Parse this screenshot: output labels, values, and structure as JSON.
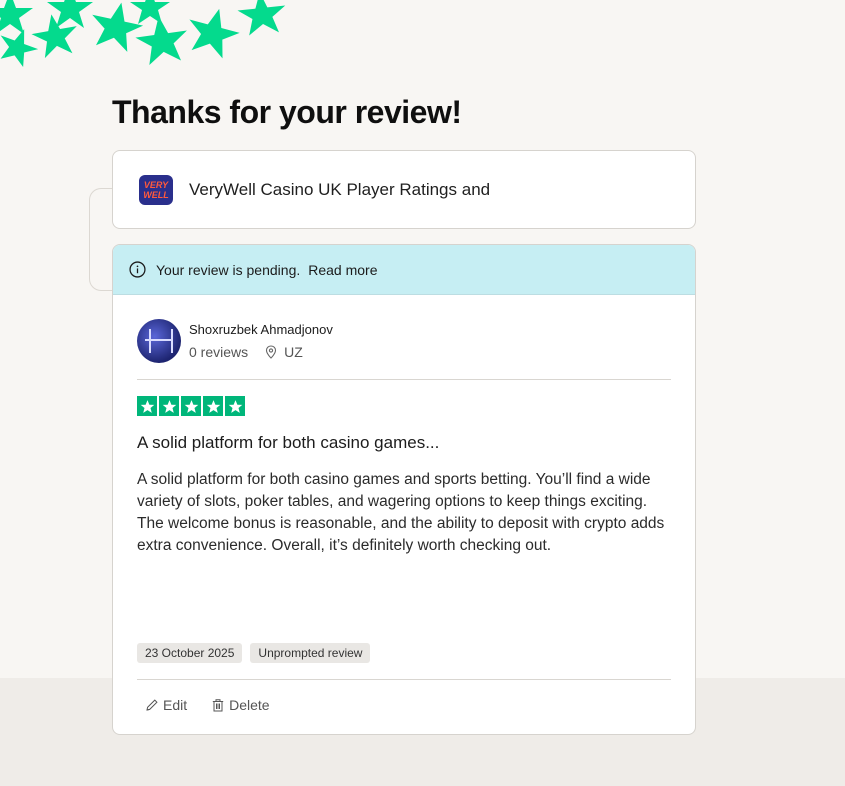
{
  "page": {
    "heading": "Thanks for your review!"
  },
  "business": {
    "logo_text_top": "VERY",
    "logo_text_bottom": "WELL",
    "name": "VeryWell Casino UK Player Ratings and"
  },
  "pending": {
    "icon": "info-icon",
    "message": "Your review is pending.",
    "link": "Read more"
  },
  "reviewer": {
    "name": "Shoxruzbek Ahmadjonov",
    "reviews": "0 reviews",
    "location_icon": "location-pin-icon",
    "country": "UZ"
  },
  "review": {
    "rating": 5,
    "title": "A solid platform for both casino games...",
    "body": "A solid platform for both casino games and sports betting. You’ll find a wide variety of slots, poker tables, and wagering options to keep things exciting. The welcome bonus is reasonable, and the ability to deposit with crypto adds extra convenience. Overall, it’s definitely worth checking out.",
    "date": "23 October 2025",
    "tag": "Unprompted review"
  },
  "actions": {
    "edit": "Edit",
    "delete": "Delete"
  },
  "colors": {
    "star_green": "#00b67a",
    "decor_green": "#04da8d",
    "pending_bg": "#c6eef3"
  }
}
